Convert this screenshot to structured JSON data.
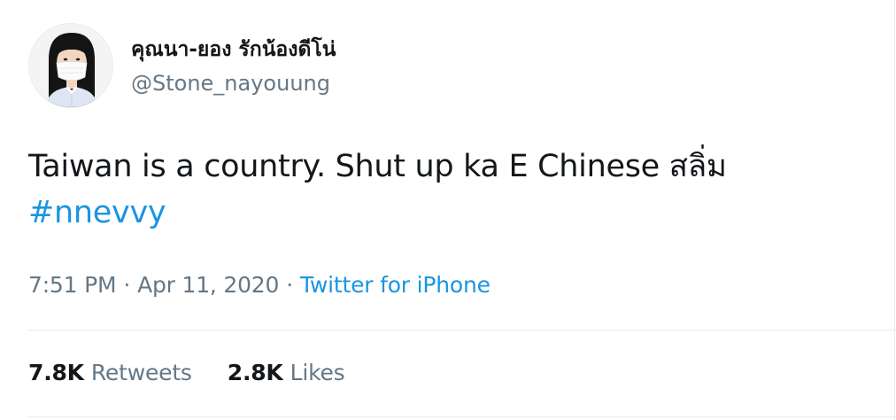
{
  "user": {
    "display_name": "คุณนา-ยอง รักน้องดีโน่",
    "handle": "@Stone_nayouung",
    "avatar": "profile-photo-woman-with-face-mask"
  },
  "tweet": {
    "text": "Taiwan is a country. Shut up ka E Chinese สลิ่ม",
    "hashtag": "#nnevvy"
  },
  "meta": {
    "time": "7:51 PM",
    "separator": "·",
    "date": "Apr 11, 2020",
    "source": "Twitter for iPhone"
  },
  "stats": {
    "retweets_count": "7.8K",
    "retweets_label": "Retweets",
    "likes_count": "2.8K",
    "likes_label": "Likes"
  },
  "colors": {
    "link": "#1b95e0",
    "secondary_text": "#657786",
    "primary_text": "#14171a",
    "divider": "#e6ecf0"
  }
}
